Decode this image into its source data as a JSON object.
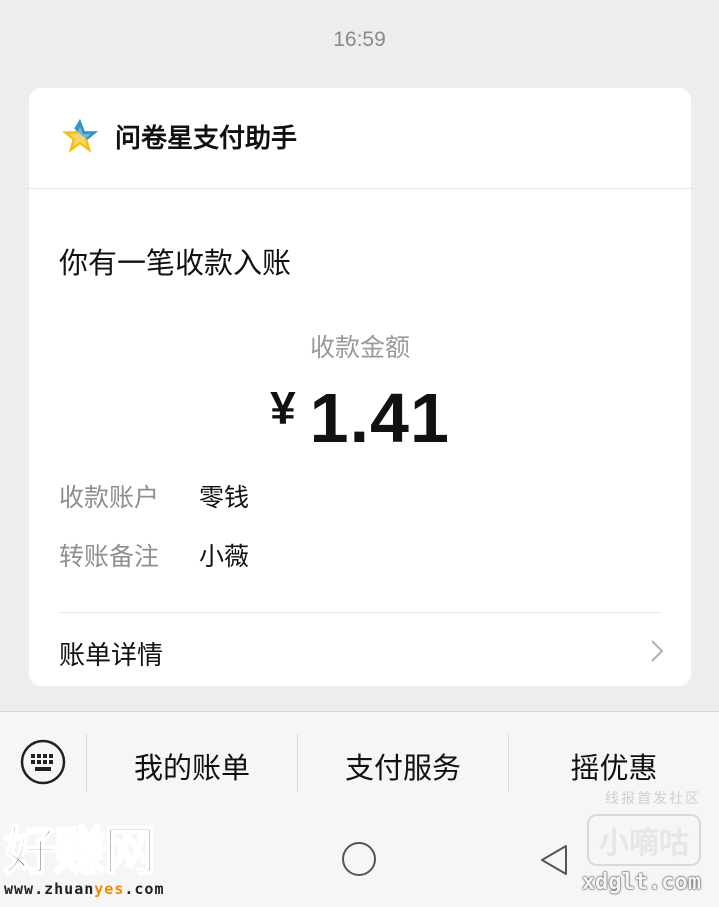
{
  "status_bar": {
    "time": "16:59"
  },
  "card": {
    "app_name": "问卷星支付助手",
    "headline": "你有一笔收款入账",
    "amount_label": "收款金额",
    "currency": "¥",
    "amount": "1.41",
    "rows": [
      {
        "key": "收款账户",
        "value": "零钱"
      },
      {
        "key": "转账备注",
        "value": "小薇"
      }
    ],
    "details_label": "账单详情"
  },
  "menu": {
    "items": [
      "我的账单",
      "支付服务",
      "摇优惠"
    ]
  },
  "watermarks": {
    "left_big": "好赚网",
    "left_url_a": "www.zhuan",
    "left_url_hl": "yes",
    "left_url_b": ".com",
    "right_top": "线报首发社区",
    "right_box": "小嘀咕",
    "right_site": "xdglt.com"
  },
  "colors": {
    "background": "#ededed",
    "card": "#ffffff",
    "logo_star_blue": "#1f8fd9",
    "logo_star_yellow": "#f5c21b"
  },
  "icons": [
    "star-logo-icon",
    "chevron-right-icon",
    "keyboard-icon",
    "home-circle-icon",
    "back-triangle-icon"
  ]
}
